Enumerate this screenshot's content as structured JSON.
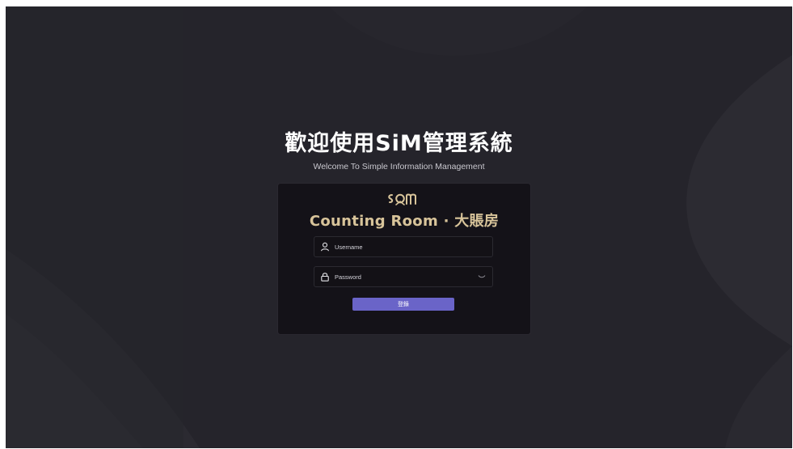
{
  "hero": {
    "title": "歡迎使用SiM管理系統",
    "subtitle": "Welcome To Simple Information Management"
  },
  "login": {
    "logo_icon": "sim-logo-icon",
    "brand_name": "Counting Room · 大賬房",
    "username_placeholder": "Username",
    "password_placeholder": "Password",
    "submit_label": "登錄"
  },
  "colors": {
    "background": "#25242b",
    "card": "#141218",
    "accent": "#6a64c8",
    "brand_gold": "#d8c49a"
  }
}
